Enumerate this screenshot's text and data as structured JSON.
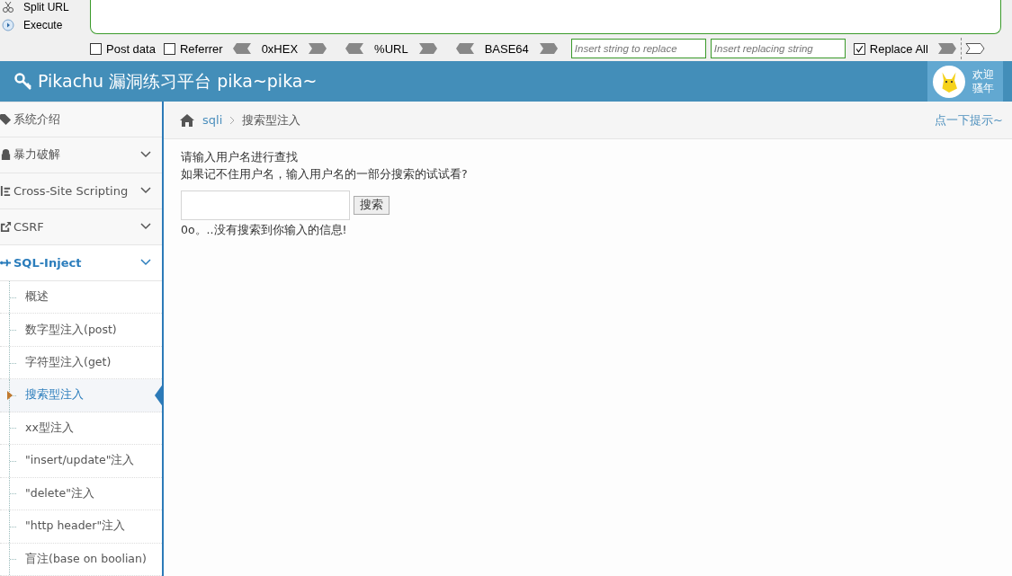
{
  "hackbar": {
    "actions": [
      {
        "label": "Split URL"
      },
      {
        "label": "Execute"
      }
    ],
    "post_data": {
      "label": "Post data",
      "checked": false
    },
    "referrer": {
      "label": "Referrer",
      "checked": false
    },
    "encoders": [
      "0xHEX",
      "%URL",
      "BASE64"
    ],
    "find_field": {
      "placeholder": "Insert string to replace"
    },
    "replace_field": {
      "placeholder": "Insert replacing string"
    },
    "replace_all": {
      "label": "Replace All",
      "checked": true
    }
  },
  "header": {
    "title": "Pikachu 漏洞练习平台 pika~pika~",
    "welcome": [
      "欢迎",
      "骚年"
    ]
  },
  "sidebar": {
    "items": [
      {
        "label": "系统介绍",
        "expandable": false,
        "expanded": false
      },
      {
        "label": "暴力破解",
        "expandable": true,
        "expanded": false
      },
      {
        "label": "Cross-Site Scripting",
        "expandable": true,
        "expanded": false
      },
      {
        "label": "CSRF",
        "expandable": true,
        "expanded": false
      },
      {
        "label": "SQL-Inject",
        "expandable": true,
        "expanded": true,
        "children": [
          {
            "label": "概述",
            "selected": false
          },
          {
            "label": "数字型注入(post)",
            "selected": false
          },
          {
            "label": "字符型注入(get)",
            "selected": false
          },
          {
            "label": "搜索型注入",
            "selected": true
          },
          {
            "label": "xx型注入",
            "selected": false
          },
          {
            "label": "\"insert/update\"注入",
            "selected": false
          },
          {
            "label": "\"delete\"注入",
            "selected": false
          },
          {
            "label": "\"http header\"注入",
            "selected": false
          },
          {
            "label": "盲注(base on boolian)",
            "selected": false
          }
        ]
      }
    ]
  },
  "breadcrumb": {
    "items": [
      "sqli",
      "搜索型注入"
    ],
    "hint_link": "点一下提示~"
  },
  "content": {
    "lines": [
      "请输入用户名进行查找",
      "如果记不住用户名，输入用户名的一部分搜索的试试看?"
    ],
    "search_button": "搜索",
    "result": "0o。..没有搜索到你输入的信息!"
  }
}
